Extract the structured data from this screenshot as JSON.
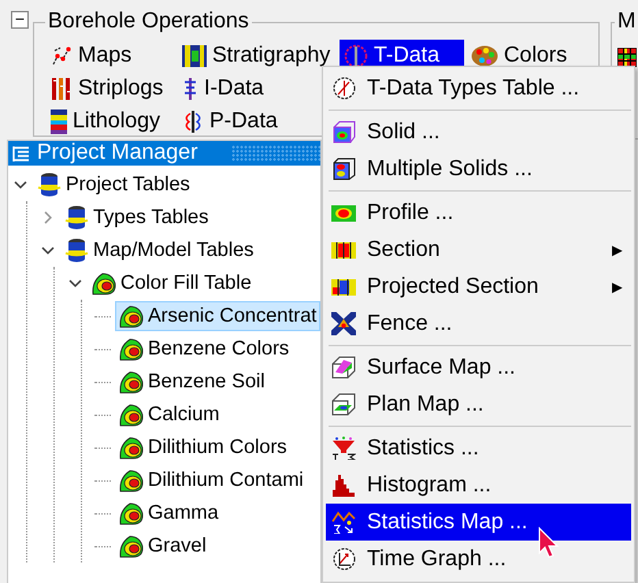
{
  "toolbar": {
    "collapse_glyph": "−",
    "title": "Borehole Operations",
    "button_rows": [
      [
        {
          "label": "Maps",
          "selected": false
        },
        {
          "label": "Stratigraphy",
          "selected": false
        },
        {
          "label": "T-Data",
          "selected": true
        },
        {
          "label": "Colors",
          "selected": false
        }
      ],
      [
        {
          "label": "Striplogs",
          "selected": false
        },
        {
          "label": "I-Data",
          "selected": false
        }
      ],
      [
        {
          "label": "Lithology",
          "selected": false
        },
        {
          "label": "P-Data",
          "selected": false
        }
      ]
    ]
  },
  "side_group": {
    "title": "M"
  },
  "project_manager": {
    "title": "Project Manager",
    "tree": [
      {
        "label": "Project Tables",
        "selected": false,
        "expanded": true,
        "children": [
          {
            "label": "Types Tables",
            "selected": false,
            "expanded": false
          },
          {
            "label": "Map/Model Tables",
            "selected": false,
            "expanded": true,
            "children": [
              {
                "label": "Color Fill Table",
                "selected": false,
                "expanded": true,
                "children": [
                  {
                    "label": "Arsenic Concentrat",
                    "selected": true
                  },
                  {
                    "label": "Benzene Colors",
                    "selected": false
                  },
                  {
                    "label": "Benzene Soil",
                    "selected": false
                  },
                  {
                    "label": "Calcium",
                    "selected": false
                  },
                  {
                    "label": "Dilithium Colors",
                    "selected": false
                  },
                  {
                    "label": "Dilithium Contami",
                    "selected": false
                  },
                  {
                    "label": "Gamma",
                    "selected": false
                  },
                  {
                    "label": "Gravel",
                    "selected": false
                  }
                ]
              }
            ]
          }
        ]
      }
    ]
  },
  "menu": {
    "groups": [
      [
        {
          "label": "T-Data Types Table ...",
          "selected": false
        }
      ],
      [
        {
          "label": "Solid ...",
          "selected": false
        },
        {
          "label": "Multiple Solids ...",
          "selected": false
        }
      ],
      [
        {
          "label": "Profile ...",
          "selected": false
        },
        {
          "label": "Section",
          "selected": false,
          "submenu_arrow": "▶"
        },
        {
          "label": "Projected Section",
          "selected": false,
          "submenu_arrow": "▶"
        },
        {
          "label": "Fence ...",
          "selected": false
        }
      ],
      [
        {
          "label": "Surface Map ...",
          "selected": false
        },
        {
          "label": "Plan Map ...",
          "selected": false
        }
      ],
      [
        {
          "label": "Statistics ...",
          "selected": false
        },
        {
          "label": "Histogram ...",
          "selected": false
        },
        {
          "label": "Statistics Map ...",
          "selected": true
        },
        {
          "label": "Time Graph ...",
          "selected": false
        }
      ]
    ]
  }
}
